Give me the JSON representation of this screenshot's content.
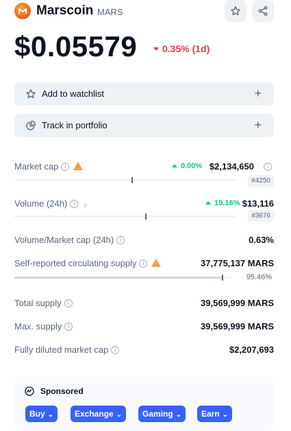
{
  "coin": {
    "name": "Marscoin",
    "symbol": "MARS",
    "price": "$0.05579",
    "change": "0.35% (1d)",
    "change_direction": "down"
  },
  "actions": {
    "watchlist_label": "Add to watchlist",
    "portfolio_label": "Track in portfolio",
    "plus": "+"
  },
  "stats": {
    "market_cap": {
      "label": "Market cap",
      "change": "0.00%",
      "value": "$2,134,650",
      "rank": "#4250"
    },
    "volume": {
      "label": "Volume (24h)",
      "change": "19.16%",
      "value": "$13,116",
      "rank": "#3676"
    },
    "vol_mcap": {
      "label": "Volume/Market cap (24h)",
      "value": "0.63%"
    },
    "circ_supply": {
      "label": "Self-reported circulating supply",
      "value": "37,775,137 MARS",
      "percent": "95.46%",
      "fraction": 0.9546
    },
    "total_supply": {
      "label": "Total supply",
      "value": "39,569,999 MARS"
    },
    "max_supply": {
      "label": "Max. supply",
      "value": "39,569,999 MARS"
    },
    "fdmc": {
      "label": "Fully diluted market cap",
      "value": "$2,207,693"
    }
  },
  "sponsored": {
    "title": "Sponsored",
    "buttons": [
      "Buy",
      "Exchange",
      "Gaming",
      "Earn"
    ]
  },
  "colors": {
    "accent": "#3861fb",
    "up": "#16c784",
    "down": "#ea3943",
    "warning": "#f0a04b"
  },
  "icons": [
    "marscoin-logo-icon",
    "star-icon",
    "share-icon",
    "plus-icon",
    "pie-chart-icon",
    "info-icon",
    "warning-icon",
    "chevron-right-icon",
    "coinmarketcap-icon",
    "chevron-down-icon"
  ]
}
